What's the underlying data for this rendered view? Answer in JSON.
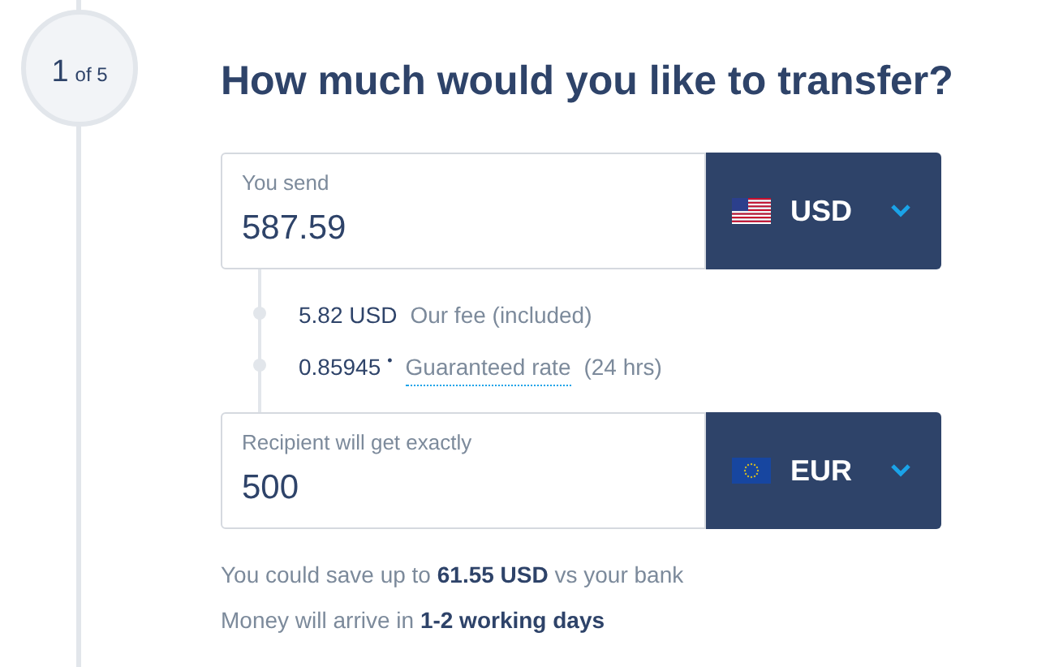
{
  "step": {
    "current": "1",
    "total": "of 5"
  },
  "title": "How much would you like to transfer?",
  "send": {
    "label": "You send",
    "value": "587.59",
    "currency": "USD",
    "kind": "us"
  },
  "fees": [
    {
      "amount": "5.82 USD",
      "text": "Our fee (included)"
    },
    {
      "amount": "0.85945",
      "marker": "•",
      "link": "Guaranteed rate",
      "text": "(24 hrs)"
    }
  ],
  "receive": {
    "label": "Recipient will get exactly",
    "value": "500",
    "currency": "EUR",
    "kind": "eu"
  },
  "notes": [
    "You could save up to **61.55 USD** vs your bank",
    "Money will arrive in **1-2 working days**"
  ]
}
